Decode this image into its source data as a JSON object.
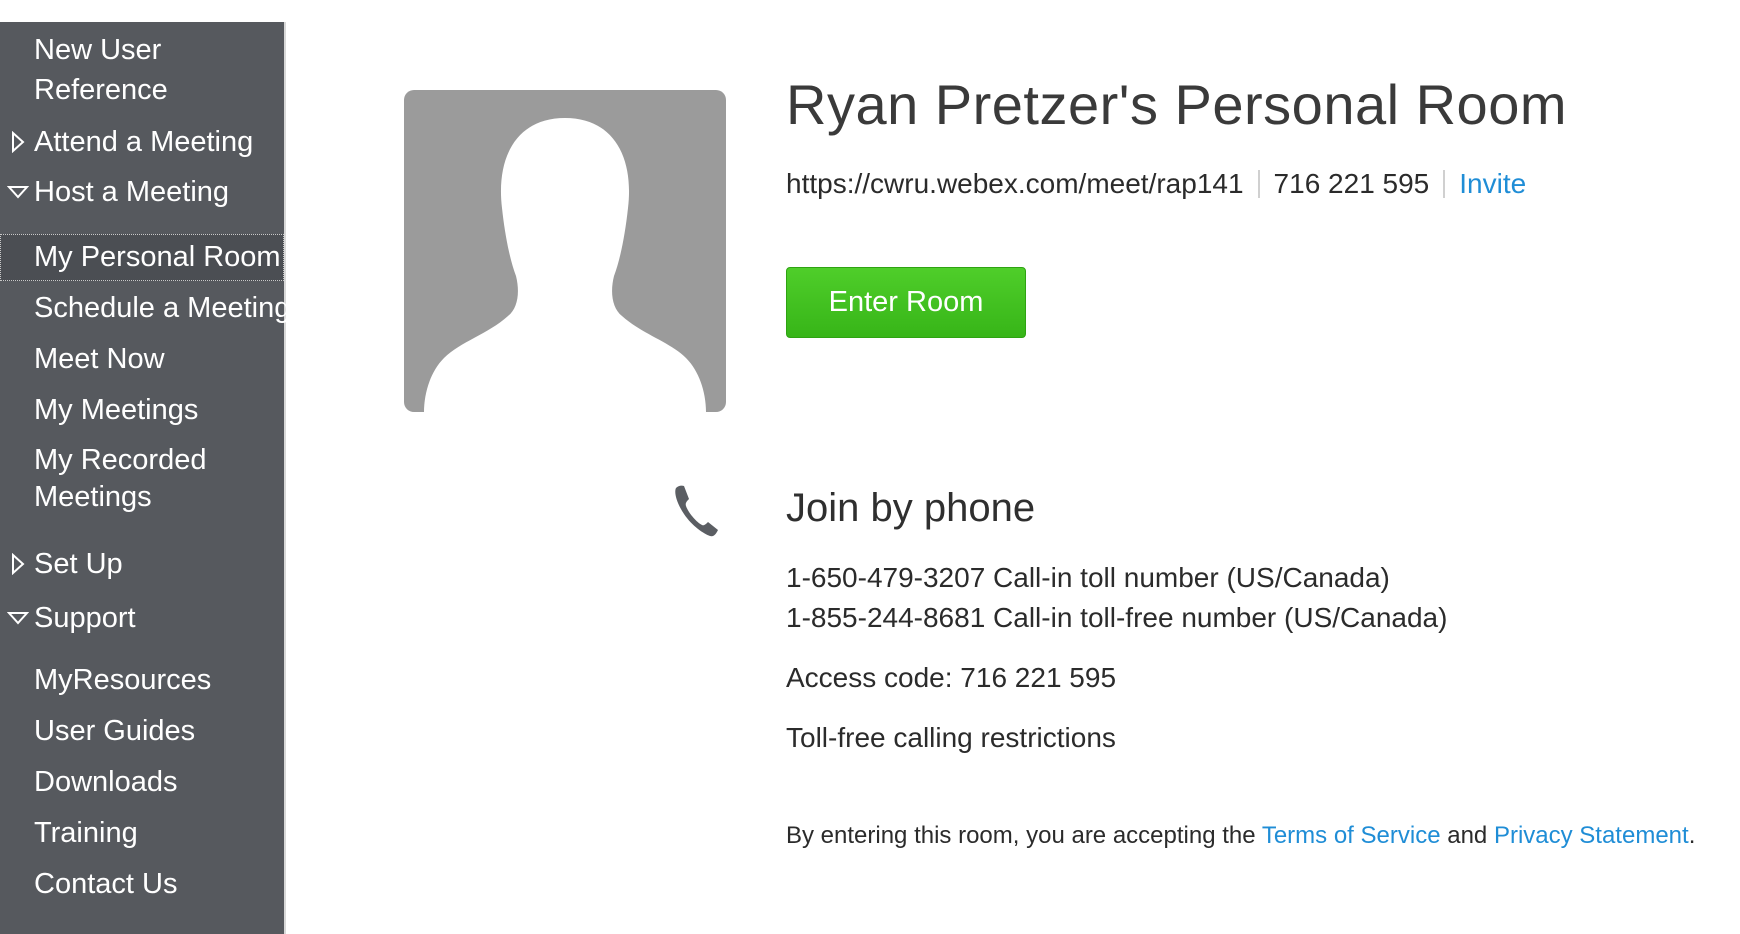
{
  "sidebar": {
    "items": [
      {
        "label_line1": "New User",
        "label_line2": "Reference"
      },
      {
        "label": "Attend a Meeting",
        "state": "collapsed"
      },
      {
        "label": "Host a Meeting",
        "state": "expanded"
      },
      {
        "label": "My Personal Room",
        "selected": true
      },
      {
        "label": "Schedule a Meeting"
      },
      {
        "label": "Meet Now"
      },
      {
        "label": "My Meetings"
      },
      {
        "label_line1": "My Recorded",
        "label_line2": "Meetings"
      },
      {
        "label": "Set Up",
        "state": "collapsed"
      },
      {
        "label": "Support",
        "state": "expanded"
      },
      {
        "label": "MyResources"
      },
      {
        "label": "User Guides"
      },
      {
        "label": "Downloads"
      },
      {
        "label": "Training"
      },
      {
        "label": "Contact Us"
      }
    ]
  },
  "room": {
    "title": "Ryan Pretzer's Personal Room",
    "url": "https://cwru.webex.com/meet/rap141",
    "meeting_number": "716 221 595",
    "invite_label": "Invite",
    "enter_button": "Enter Room"
  },
  "phone": {
    "heading": "Join by phone",
    "toll_line": "1-650-479-3207 Call-in toll number (US/Canada)",
    "tollfree_line": "1-855-244-8681 Call-in toll-free number (US/Canada)",
    "access_code": "Access code: 716 221 595",
    "restrictions_link": "Toll-free calling restrictions"
  },
  "footer": {
    "prefix": "By entering this room, you are accepting the ",
    "terms_link": "Terms of Service",
    "and": " and ",
    "privacy_link": "Privacy Statement",
    "suffix": "."
  },
  "colors": {
    "sidebar_bg": "#56595e",
    "link": "#1f8dd6",
    "button_green": "#3fbf1f",
    "avatar_bg": "#9b9b9b"
  },
  "icons": {
    "collapsed": "triangle-right-icon",
    "expanded": "triangle-down-icon",
    "phone": "phone-icon",
    "avatar": "user-silhouette-icon"
  }
}
